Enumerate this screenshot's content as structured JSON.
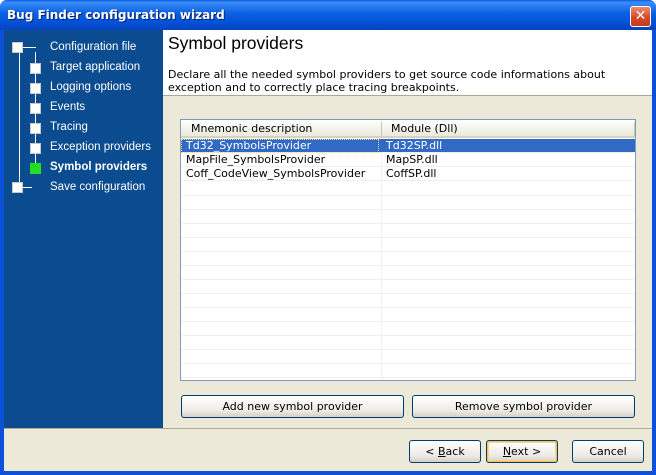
{
  "window": {
    "title": "Bug Finder configuration wizard",
    "close_glyph": "✕"
  },
  "sidebar": {
    "items": [
      {
        "label": "Configuration file",
        "active": false
      },
      {
        "label": "Target application",
        "active": false
      },
      {
        "label": "Logging options",
        "active": false
      },
      {
        "label": "Events",
        "active": false
      },
      {
        "label": "Tracing",
        "active": false
      },
      {
        "label": "Exception providers",
        "active": false
      },
      {
        "label": "Symbol providers",
        "active": true
      },
      {
        "label": "Save configuration",
        "active": false
      }
    ],
    "active_color": "#22dd22"
  },
  "page": {
    "title": "Symbol providers",
    "description": "Declare all the needed symbol providers to get source code informations about exception and to correctly place tracing breakpoints."
  },
  "grid": {
    "columns": [
      "Mnemonic description",
      "Module (Dll)"
    ],
    "rows": [
      {
        "name": "Td32_SymbolsProvider",
        "module": "Td32SP.dll",
        "selected": true
      },
      {
        "name": "MapFile_SymbolsProvider",
        "module": "MapSP.dll",
        "selected": false
      },
      {
        "name": "Coff_CodeView_SymbolsProvider",
        "module": "CoffSP.dll",
        "selected": false
      }
    ],
    "selection_color": "#316ac5"
  },
  "actions": {
    "add_label": "Add new symbol provider",
    "remove_label": "Remove symbol provider"
  },
  "footer": {
    "back_prefix": "< ",
    "back_key": "B",
    "back_rest": "ack",
    "next_key": "N",
    "next_rest": "ext >",
    "cancel_label": "Cancel"
  }
}
